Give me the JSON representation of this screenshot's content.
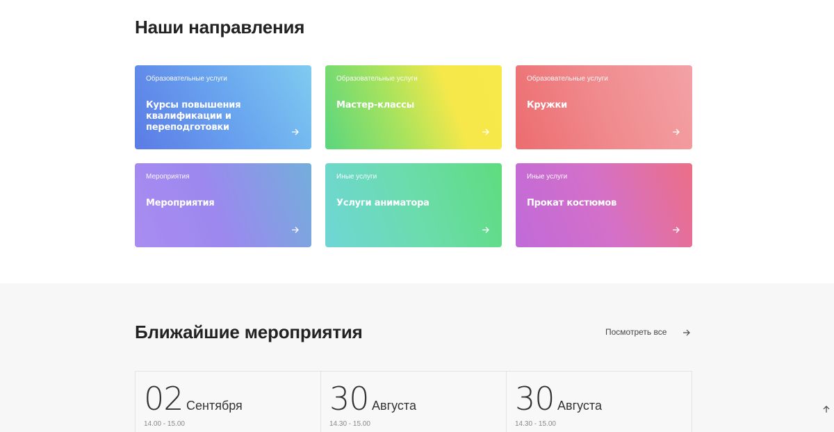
{
  "directions": {
    "title": "Наши направления",
    "cards": [
      {
        "category": "Образовательные услуги",
        "title": "Курсы повышения квалификации и переподготовки"
      },
      {
        "category": "Образовательные услуги",
        "title": "Мастер-классы"
      },
      {
        "category": "Образовательные услуги",
        "title": "Кружки"
      },
      {
        "category": "Мероприятия",
        "title": "Мероприятия"
      },
      {
        "category": "Иные услуги",
        "title": "Услуги аниматора"
      },
      {
        "category": "Иные услуги",
        "title": "Прокат костюмов"
      }
    ]
  },
  "events": {
    "title": "Ближайшие мероприятия",
    "see_all": "Посмотреть все",
    "items": [
      {
        "day": "02",
        "month": "Сентября",
        "time": "14.00 - 15.00"
      },
      {
        "day": "30",
        "month": "Августа",
        "time": "14.30 - 15.00"
      },
      {
        "day": "30",
        "month": "Августа",
        "time": "14.30 - 15.00"
      }
    ]
  },
  "icons": {
    "card_arrow": "arrow-right-icon",
    "see_all_arrow": "arrow-right-icon",
    "scroll_top": "arrow-up-icon"
  },
  "colors": {
    "background": "#ffffff",
    "events_background": "#f7f7f7",
    "text": "#222222"
  }
}
